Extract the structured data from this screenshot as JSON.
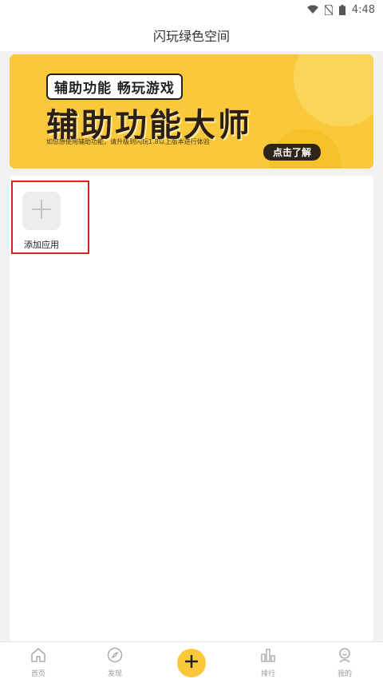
{
  "status_bar": {
    "time": "4:48"
  },
  "header": {
    "title": "闪玩绿色空间"
  },
  "banner": {
    "tagline": "辅助功能 畅玩游戏",
    "title": "辅助功能大师",
    "subtitle": "如您想使用辅助功能，请升级到闪玩1.8以上版本进行体验",
    "cta": "点击了解"
  },
  "apps": {
    "add_label": "添加应用"
  },
  "nav": {
    "home": "首页",
    "discover": "发现",
    "ranking": "排行",
    "mine": "我的"
  },
  "colors": {
    "accent": "#f9c93b",
    "highlight_border": "#d8231f"
  }
}
